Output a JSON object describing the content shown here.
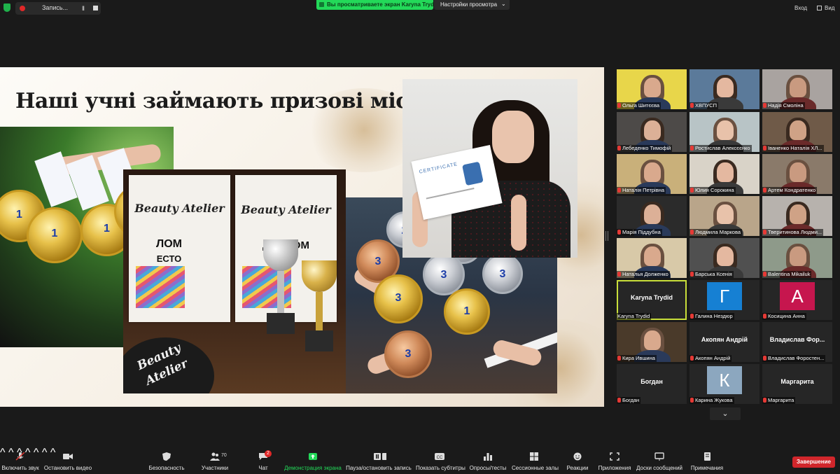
{
  "topbar": {
    "record_label": "Запись...",
    "pause_glyph": "II",
    "sharing_banner": "Вы просматриваете экран Karyna Trydid",
    "view_options": "Настройки просмотра",
    "view_options_chevron": "⌄",
    "enter_label": "Вход",
    "view_label": "Вид"
  },
  "slide": {
    "title": "Наші учні займають призові місця!",
    "diploma_brand": "Beauty Atelier",
    "diploma_label": "ДИПЛОМ",
    "diploma_label_partial": "ЛОМ",
    "diploma_place": "ЕСТО",
    "package_brand_1": "Beauty",
    "package_brand_2": "Atelier",
    "certificate_label": "CERTIFICATE",
    "medal_numbers": [
      "1",
      "1",
      "3",
      "1",
      "3",
      "2",
      "1",
      "3",
      "1",
      "3",
      "1"
    ]
  },
  "participants": [
    {
      "name": "Ольга Шитєєва"
    },
    {
      "name": "ХВПУСП"
    },
    {
      "name": "Надія Смоліна"
    },
    {
      "name": "Лебеденко Тимофій"
    },
    {
      "name": "Ростислав Алексєєнко"
    },
    {
      "name": "Іваненко Наталія ХЛ..."
    },
    {
      "name": "Наталія Петрівна"
    },
    {
      "name": "Юлия Сорокина"
    },
    {
      "name": "Артем Кондратенко"
    },
    {
      "name": "Марія Піддубна"
    },
    {
      "name": "Людмила Маркова"
    },
    {
      "name": "Тверитинова Людми..."
    },
    {
      "name": "Наталья Долженко"
    },
    {
      "name": "Барська Ксенія"
    },
    {
      "name": "Balentina Mikailuk"
    },
    {
      "name": "Karyna Trydid",
      "big": "Karyna Trydid"
    },
    {
      "name": "Галина Нездюр",
      "initial": "Г",
      "color": "#1680d3"
    },
    {
      "name": "Косицина Анна",
      "initial": "А",
      "color": "#c6164e"
    },
    {
      "name": "Кира Ившина"
    },
    {
      "name": "Акопян Андрій",
      "big": "Акопян Андрій"
    },
    {
      "name": "Владислав Форостен...",
      "big": "Владислав Фор..."
    },
    {
      "name": "Богдан",
      "big": "Богдан"
    },
    {
      "name": "Карина Жукова",
      "initial": "К",
      "color": "#8ca7bf"
    },
    {
      "name": "Маргарита",
      "big": "Маргарита"
    }
  ],
  "gallery_more": "⌄",
  "toolbar": {
    "unmute": "Включить звук",
    "stop_video": "Остановить видео",
    "security": "Безопасность",
    "participants": "Участники",
    "participants_count": "70",
    "chat": "Чат",
    "chat_badge": "2",
    "share_screen": "Демонстрация экрана",
    "pause_record": "Пауза/остановить запись",
    "subtitles": "Показать субтитры",
    "polls": "Опросы/тесты",
    "breakout": "Сессионные залы",
    "reactions": "Реакции",
    "apps": "Приложения",
    "whiteboards": "Доски сообщений",
    "notes": "Примечания",
    "caret": "^",
    "end": "Завершение"
  },
  "colors": {
    "share_green": "#23d959",
    "end_red": "#d1262b",
    "active_speaker": "#c9df3a"
  }
}
